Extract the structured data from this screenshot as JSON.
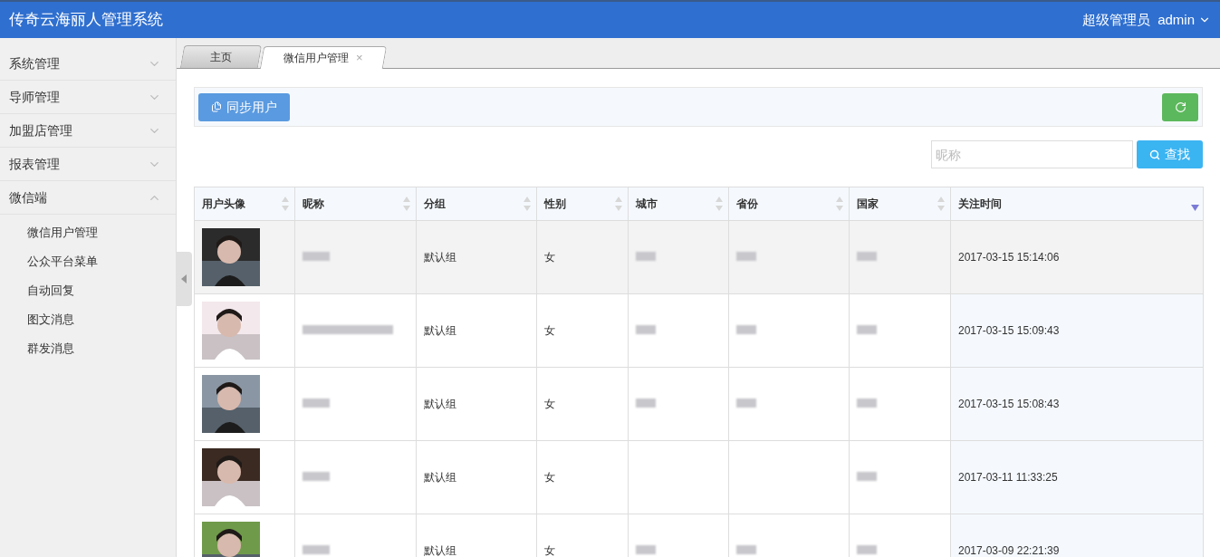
{
  "header": {
    "title": "传奇云海丽人管理系统",
    "role": "超级管理员",
    "user": "admin"
  },
  "sidebar": {
    "items": [
      {
        "label": "系统管理",
        "expanded": false
      },
      {
        "label": "导师管理",
        "expanded": false
      },
      {
        "label": "加盟店管理",
        "expanded": false
      },
      {
        "label": "报表管理",
        "expanded": false
      },
      {
        "label": "微信端",
        "expanded": true,
        "children": [
          {
            "label": "微信用户管理"
          },
          {
            "label": "公众平台菜单"
          },
          {
            "label": "自动回复"
          },
          {
            "label": "图文消息"
          },
          {
            "label": "群发消息"
          }
        ]
      }
    ]
  },
  "tabs": [
    {
      "label": "主页",
      "selected": false
    },
    {
      "label": "微信用户管理",
      "selected": true,
      "close": "×"
    }
  ],
  "toolbar": {
    "sync_button": "同步用户"
  },
  "search": {
    "placeholder": "昵称",
    "button": "查找"
  },
  "table": {
    "columns": [
      {
        "label": "用户头像",
        "sorted": false
      },
      {
        "label": "昵称",
        "sorted": false
      },
      {
        "label": "分组",
        "sorted": false
      },
      {
        "label": "性别",
        "sorted": false
      },
      {
        "label": "城市",
        "sorted": false
      },
      {
        "label": "省份",
        "sorted": false
      },
      {
        "label": "国家",
        "sorted": false
      },
      {
        "label": "关注时间",
        "sorted": true
      }
    ],
    "rows": [
      {
        "highlighted": true,
        "nickname_redacted": true,
        "group": "默认组",
        "gender": "女",
        "city_redacted": true,
        "province_redacted": true,
        "country_redacted": true,
        "time": "2017-03-15 15:14:06"
      },
      {
        "highlighted": false,
        "nickname_redacted": true,
        "group": "默认组",
        "gender": "女",
        "city_redacted": true,
        "province_redacted": true,
        "country_redacted": true,
        "time": "2017-03-15 15:09:43"
      },
      {
        "highlighted": false,
        "nickname_redacted": true,
        "group": "默认组",
        "gender": "女",
        "city_redacted": true,
        "province_redacted": true,
        "country_redacted": true,
        "time": "2017-03-15 15:08:43"
      },
      {
        "highlighted": false,
        "nickname_redacted": true,
        "group": "默认组",
        "gender": "女",
        "city_redacted": false,
        "province_redacted": false,
        "country_redacted": true,
        "time": "2017-03-11 11:33:25"
      },
      {
        "highlighted": false,
        "nickname_redacted": true,
        "group": "默认组",
        "gender": "女",
        "city_redacted": true,
        "province_redacted": true,
        "country_redacted": true,
        "time": "2017-03-09 22:21:39"
      }
    ]
  }
}
